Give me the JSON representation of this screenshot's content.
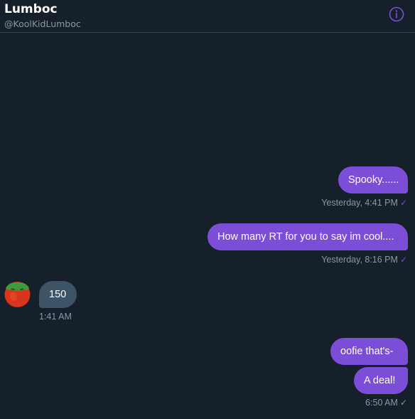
{
  "header": {
    "name": "Lumboc",
    "handle": "@KoolKidLumboc",
    "info_icon": "info-icon"
  },
  "colors": {
    "background": "#15202b",
    "accent": "#7c4dd6",
    "received_bubble": "#3d5466",
    "muted_text": "#8899a6"
  },
  "messages": [
    {
      "direction": "sent",
      "text": "Spooky......",
      "time": "Yesterday, 4:41 PM",
      "status": "read-check-icon"
    },
    {
      "direction": "sent",
      "text": "How many RT for you to say im cool....",
      "time": "Yesterday, 8:16 PM",
      "status": "read-check-icon"
    },
    {
      "direction": "received",
      "text": "150",
      "time": "1:41 AM",
      "avatar": "tomato-avatar"
    },
    {
      "direction": "sent",
      "text": "oofie that's-"
    },
    {
      "direction": "sent",
      "text": "A deal!",
      "time": "6:50 AM",
      "status": "sent-check-icon"
    }
  ]
}
